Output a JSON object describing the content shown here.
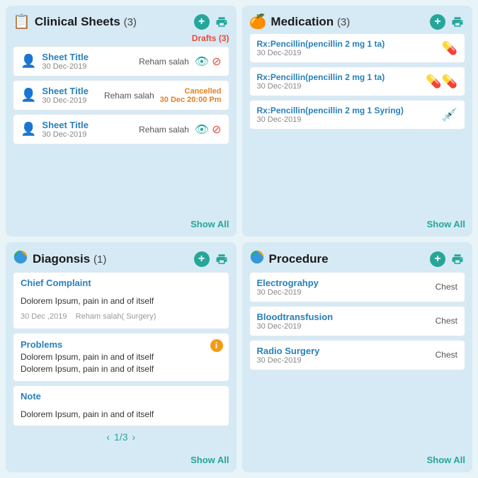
{
  "clinicalSheets": {
    "title": "Clinical Sheets",
    "count": "(3)",
    "icon": "📋",
    "drafts_label": "Drafts",
    "drafts_count": "(3)",
    "items": [
      {
        "title": "Sheet Title",
        "date": "30 Dec-2019",
        "name": "Reham salah",
        "status": "eye_block"
      },
      {
        "title": "Sheet Title",
        "date": "30 Dec-2019",
        "name": "Reham salah",
        "status": "cancelled",
        "cancelled_text": "Cancelled",
        "cancelled_date": "30 Dec 20:00 Pm"
      },
      {
        "title": "Sheet Title",
        "date": "30 Dec-2019",
        "name": "Reham salah",
        "status": "eye_block"
      }
    ],
    "show_all": "Show All"
  },
  "medication": {
    "title": "Medication",
    "count": "(3)",
    "icon": "💊",
    "items": [
      {
        "title": "Rx:Pencillin(pencillin 2 mg  1 ta)",
        "date": "30 Dec-2019",
        "icon": "💊"
      },
      {
        "title": "Rx:Pencillin(pencillin 2 mg  1 ta)",
        "date": "30 Dec-2019",
        "icon": "💊💊"
      },
      {
        "title": "Rx:Pencillin(pencillin 2 mg  1 Syring)",
        "date": "30 Dec-2019",
        "icon": "💉"
      }
    ],
    "show_all": "Show All"
  },
  "diagnosis": {
    "title": "Diagonsis",
    "count": "(1)",
    "icon": "📊",
    "chief_complaint": {
      "label": "Chief Complaint",
      "text": "Dolorem Ipsum, pain in and of itself",
      "meta": "30 Dec ,2019",
      "doctor": "Reham salah( Surgery)"
    },
    "problems": {
      "label": "Problems",
      "lines": [
        "Dolorem Ipsum, pain in and of itself",
        "Dolorem Ipsum, pain in and of itself"
      ]
    },
    "note": {
      "label": "Note",
      "text": "Dolorem Ipsum, pain in and of itself"
    },
    "pagination": "1/3",
    "show_all": "Show All"
  },
  "procedure": {
    "title": "Procedure",
    "icon": "🔵",
    "items": [
      {
        "title": "Electrograhpy",
        "date": "30 Dec-2019",
        "location": "Chest"
      },
      {
        "title": "Bloodtransfusion",
        "date": "30 Dec-2019",
        "location": "Chest"
      },
      {
        "title": "Radio Surgery",
        "date": "30 Dec-2019",
        "location": "Chest"
      }
    ],
    "show_all": "Show All"
  }
}
